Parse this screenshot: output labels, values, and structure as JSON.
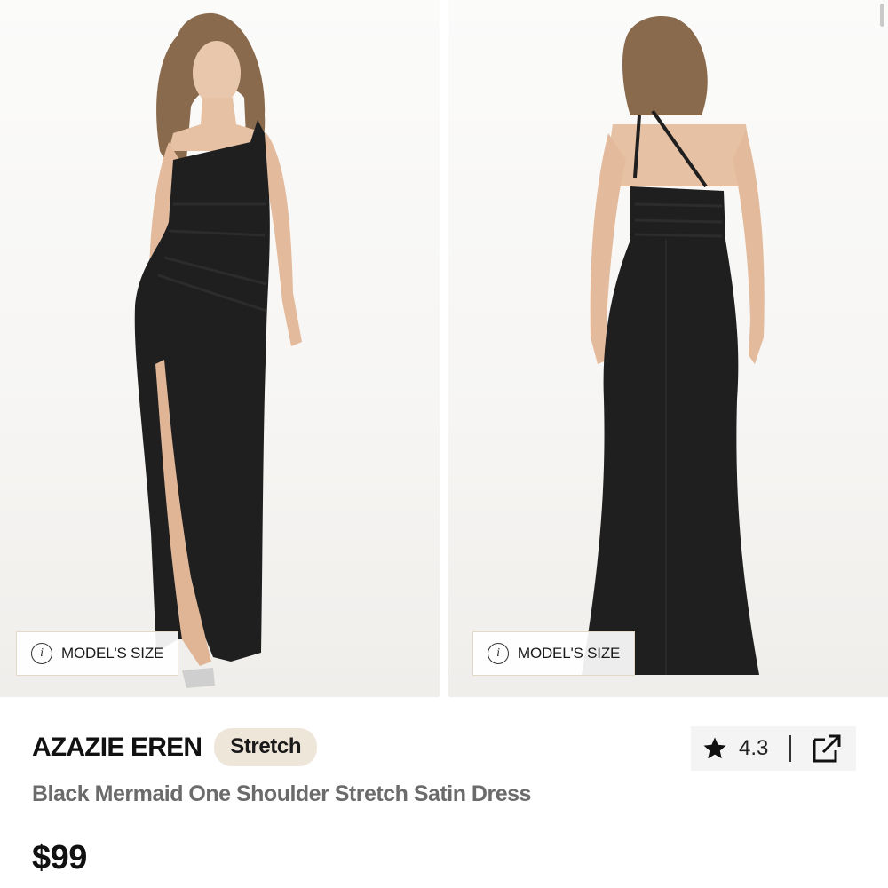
{
  "gallery": {
    "images": [
      {
        "alt": "front view",
        "model_size_label": "MODEL'S SIZE"
      },
      {
        "alt": "back view",
        "model_size_label": "MODEL'S SIZE"
      }
    ]
  },
  "product": {
    "brand": "AZAZIE EREN",
    "tag": "Stretch",
    "name": "Black Mermaid One Shoulder Stretch Satin Dress",
    "price": "$99",
    "rating": "4.3"
  },
  "icons": {
    "info": "info-icon",
    "star": "star-icon",
    "share": "external-link-icon"
  },
  "colors": {
    "dress": "#1f1f1f",
    "tag_bg": "#efe6da",
    "name_text": "#6b6b6b",
    "actions_bg": "#f4f4f4"
  }
}
